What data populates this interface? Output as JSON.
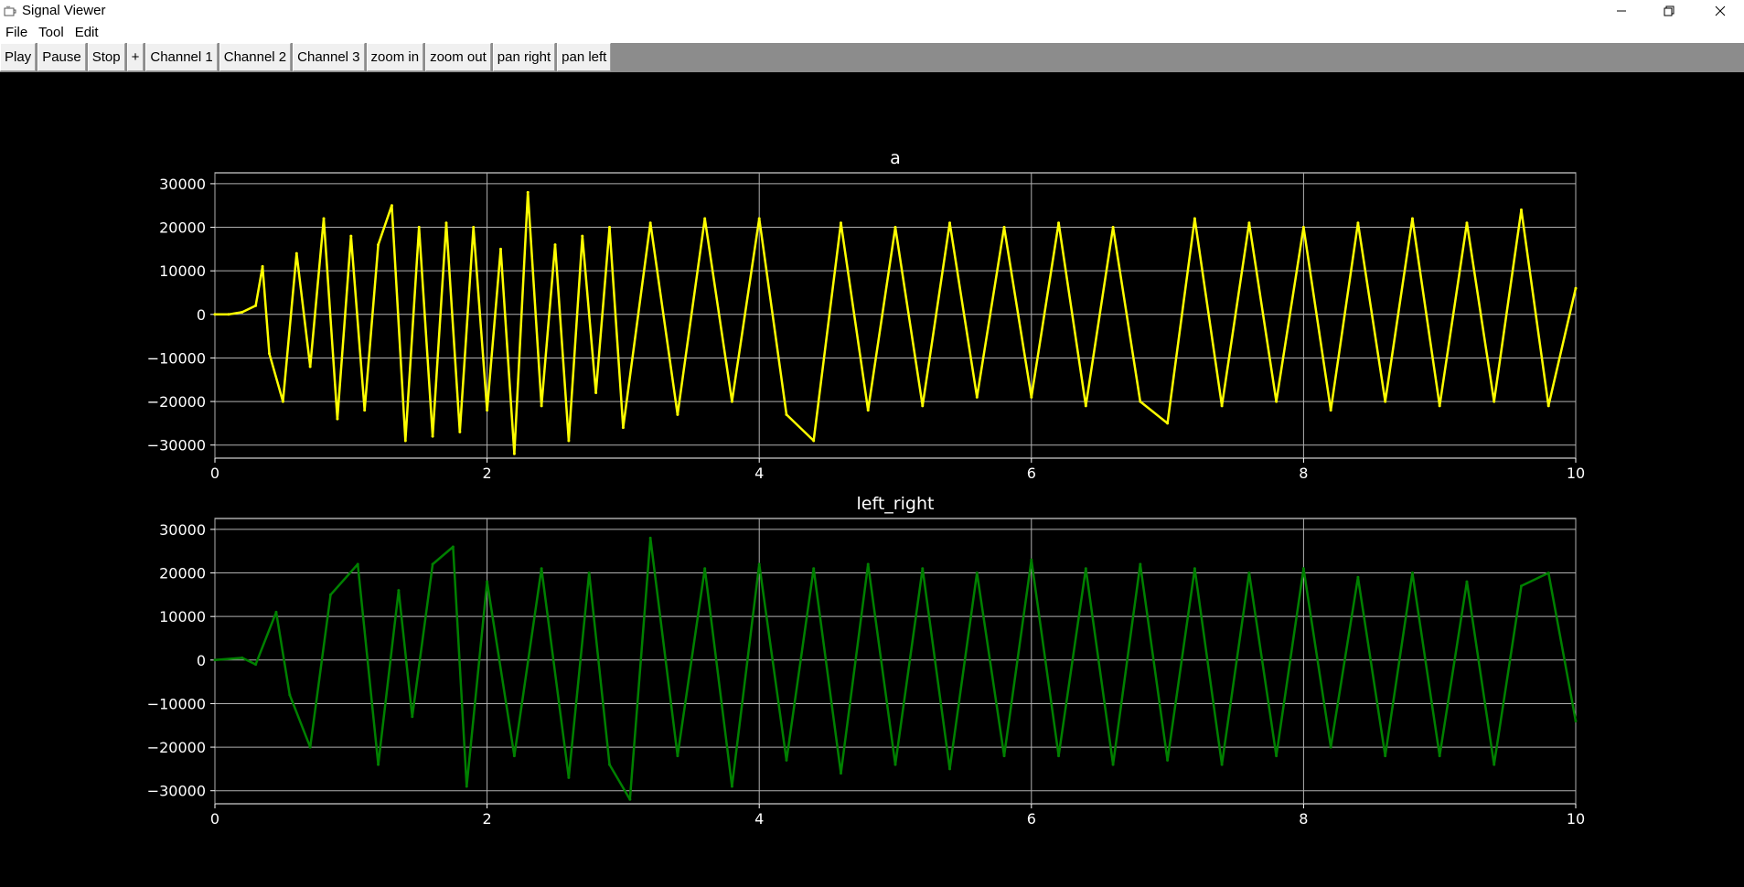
{
  "window": {
    "title": "Signal Viewer",
    "icon": "app-window-icon",
    "controls": [
      "minimize-icon",
      "restore-icon",
      "close-icon"
    ]
  },
  "menu": {
    "items": [
      "File",
      "Tool",
      "Edit"
    ]
  },
  "toolbar": {
    "buttons": [
      "Play",
      "Pause",
      "Stop",
      "+",
      "Channel 1",
      "Channel 2",
      "Channel 3",
      "zoom in",
      "zoom out",
      "pan right",
      "pan left"
    ]
  },
  "chart_data": [
    {
      "type": "line",
      "title": "a",
      "xlim": [
        0,
        10
      ],
      "ylim": [
        -33000,
        32500
      ],
      "xticks": [
        "0",
        "2",
        "4",
        "6",
        "8",
        "10"
      ],
      "yticks": [
        "30000",
        "20000",
        "10000",
        "0",
        "−10000",
        "−20000",
        "−30000"
      ],
      "grid": true,
      "series": [
        {
          "color": "#ffff00",
          "x": [
            0,
            0.1,
            0.2,
            0.3,
            0.35,
            0.4,
            0.5,
            0.6,
            0.7,
            0.8,
            0.9,
            1.0,
            1.1,
            1.2,
            1.3,
            1.4,
            1.5,
            1.6,
            1.7,
            1.8,
            1.9,
            2.0,
            2.1,
            2.2,
            2.3,
            2.4,
            2.5,
            2.6,
            2.7,
            2.8,
            2.9,
            3.0,
            3.2,
            3.4,
            3.6,
            3.8,
            4.0,
            4.2,
            4.4,
            4.6,
            4.8,
            5.0,
            5.2,
            5.4,
            5.6,
            5.8,
            6.0,
            6.2,
            6.4,
            6.6,
            6.8,
            7.0,
            7.2,
            7.4,
            7.6,
            7.8,
            8.0,
            8.2,
            8.4,
            8.6,
            8.8,
            9.0,
            9.2,
            9.4,
            9.6,
            9.8,
            10.0
          ],
          "y": [
            0,
            0,
            500,
            2000,
            11000,
            -9000,
            -20000,
            14000,
            -12000,
            22000,
            -24000,
            18000,
            -22000,
            16000,
            25000,
            -29000,
            20000,
            -28000,
            21000,
            -27000,
            20000,
            -22000,
            15000,
            -32000,
            28000,
            -21000,
            16000,
            -29000,
            18000,
            -18000,
            20000,
            -26000,
            21000,
            -23000,
            22000,
            -20000,
            22000,
            -23000,
            -29000,
            21000,
            -22000,
            20000,
            -21000,
            21000,
            -19000,
            20000,
            -19000,
            21000,
            -21000,
            20000,
            -20000,
            -25000,
            22000,
            -21000,
            21000,
            -20000,
            20000,
            -22000,
            21000,
            -20000,
            22000,
            -21000,
            21000,
            -20000,
            24000,
            -21000,
            6000
          ]
        }
      ]
    },
    {
      "type": "line",
      "title": "left_right",
      "xlim": [
        0,
        10
      ],
      "ylim": [
        -33000,
        32500
      ],
      "xticks": [
        "0",
        "2",
        "4",
        "6",
        "8",
        "10"
      ],
      "yticks": [
        "30000",
        "20000",
        "10000",
        "0",
        "−10000",
        "−20000",
        "−30000"
      ],
      "grid": true,
      "series": [
        {
          "color": "#008000",
          "x": [
            0,
            0.2,
            0.3,
            0.45,
            0.55,
            0.7,
            0.85,
            1.05,
            1.2,
            1.35,
            1.45,
            1.6,
            1.75,
            1.85,
            2.0,
            2.2,
            2.4,
            2.6,
            2.75,
            2.9,
            3.05,
            3.2,
            3.4,
            3.6,
            3.8,
            4.0,
            4.2,
            4.4,
            4.6,
            4.8,
            5.0,
            5.2,
            5.4,
            5.6,
            5.8,
            6.0,
            6.2,
            6.4,
            6.6,
            6.8,
            7.0,
            7.2,
            7.4,
            7.6,
            7.8,
            8.0,
            8.2,
            8.4,
            8.6,
            8.8,
            9.0,
            9.2,
            9.4,
            9.6,
            9.8,
            10.0
          ],
          "y": [
            0,
            500,
            -1000,
            11000,
            -8000,
            -20000,
            15000,
            22000,
            -24000,
            16000,
            -13000,
            22000,
            26000,
            -29000,
            18000,
            -22000,
            21000,
            -27000,
            20000,
            -24000,
            -32000,
            28000,
            -22000,
            21000,
            -29000,
            22000,
            -23000,
            21000,
            -26000,
            22000,
            -24000,
            21000,
            -25000,
            20000,
            -22000,
            23000,
            -22000,
            21000,
            -24000,
            22000,
            -23000,
            21000,
            -24000,
            20000,
            -22000,
            21000,
            -20000,
            19000,
            -22000,
            20000,
            -22000,
            18000,
            -24000,
            17000,
            20000,
            -14000
          ]
        }
      ]
    }
  ]
}
